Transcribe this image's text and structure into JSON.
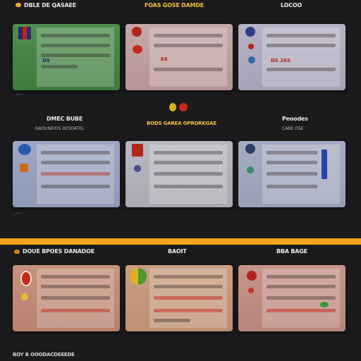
{
  "section1": {
    "col1_header": "DBLE DE QASAEE",
    "col2_header": "FOAS GOSE DAMDE",
    "col3_header": "LOCOO"
  },
  "section2": {
    "col1_header": "DMEC BUBE",
    "col1_sub": "DAOUNEIOS DESDATEL",
    "col2_header": "BODS GAREA OPRORKGAE",
    "col3_header": "Peoodes",
    "col3_sub": "CABE OSE"
  },
  "section3": {
    "col1_header": "DOUE BPOES DANADOE",
    "col2_header": "BAOIT",
    "col3_header": "BBA BAGE"
  },
  "cards": [
    {
      "tag": "DS",
      "accent": "#b3241c"
    },
    {
      "tag": "E6",
      "accent": "#b3241c"
    },
    {
      "tag": "DS 26S",
      "accent": "#b3241c"
    },
    {
      "tag": "",
      "accent": "#b3241c"
    },
    {
      "tag": "",
      "accent": "#b3241c"
    },
    {
      "tag": "",
      "accent": "#b3241c"
    },
    {
      "tag": "",
      "accent": "#b3241c"
    },
    {
      "tag": "",
      "accent": "#b3241c"
    },
    {
      "tag": "",
      "accent": "#b3241c"
    }
  ],
  "footer_text": "BOY B OOODACDEEEDE",
  "colors": {
    "band": "#f3a21a",
    "background": "#1b1b1d"
  }
}
